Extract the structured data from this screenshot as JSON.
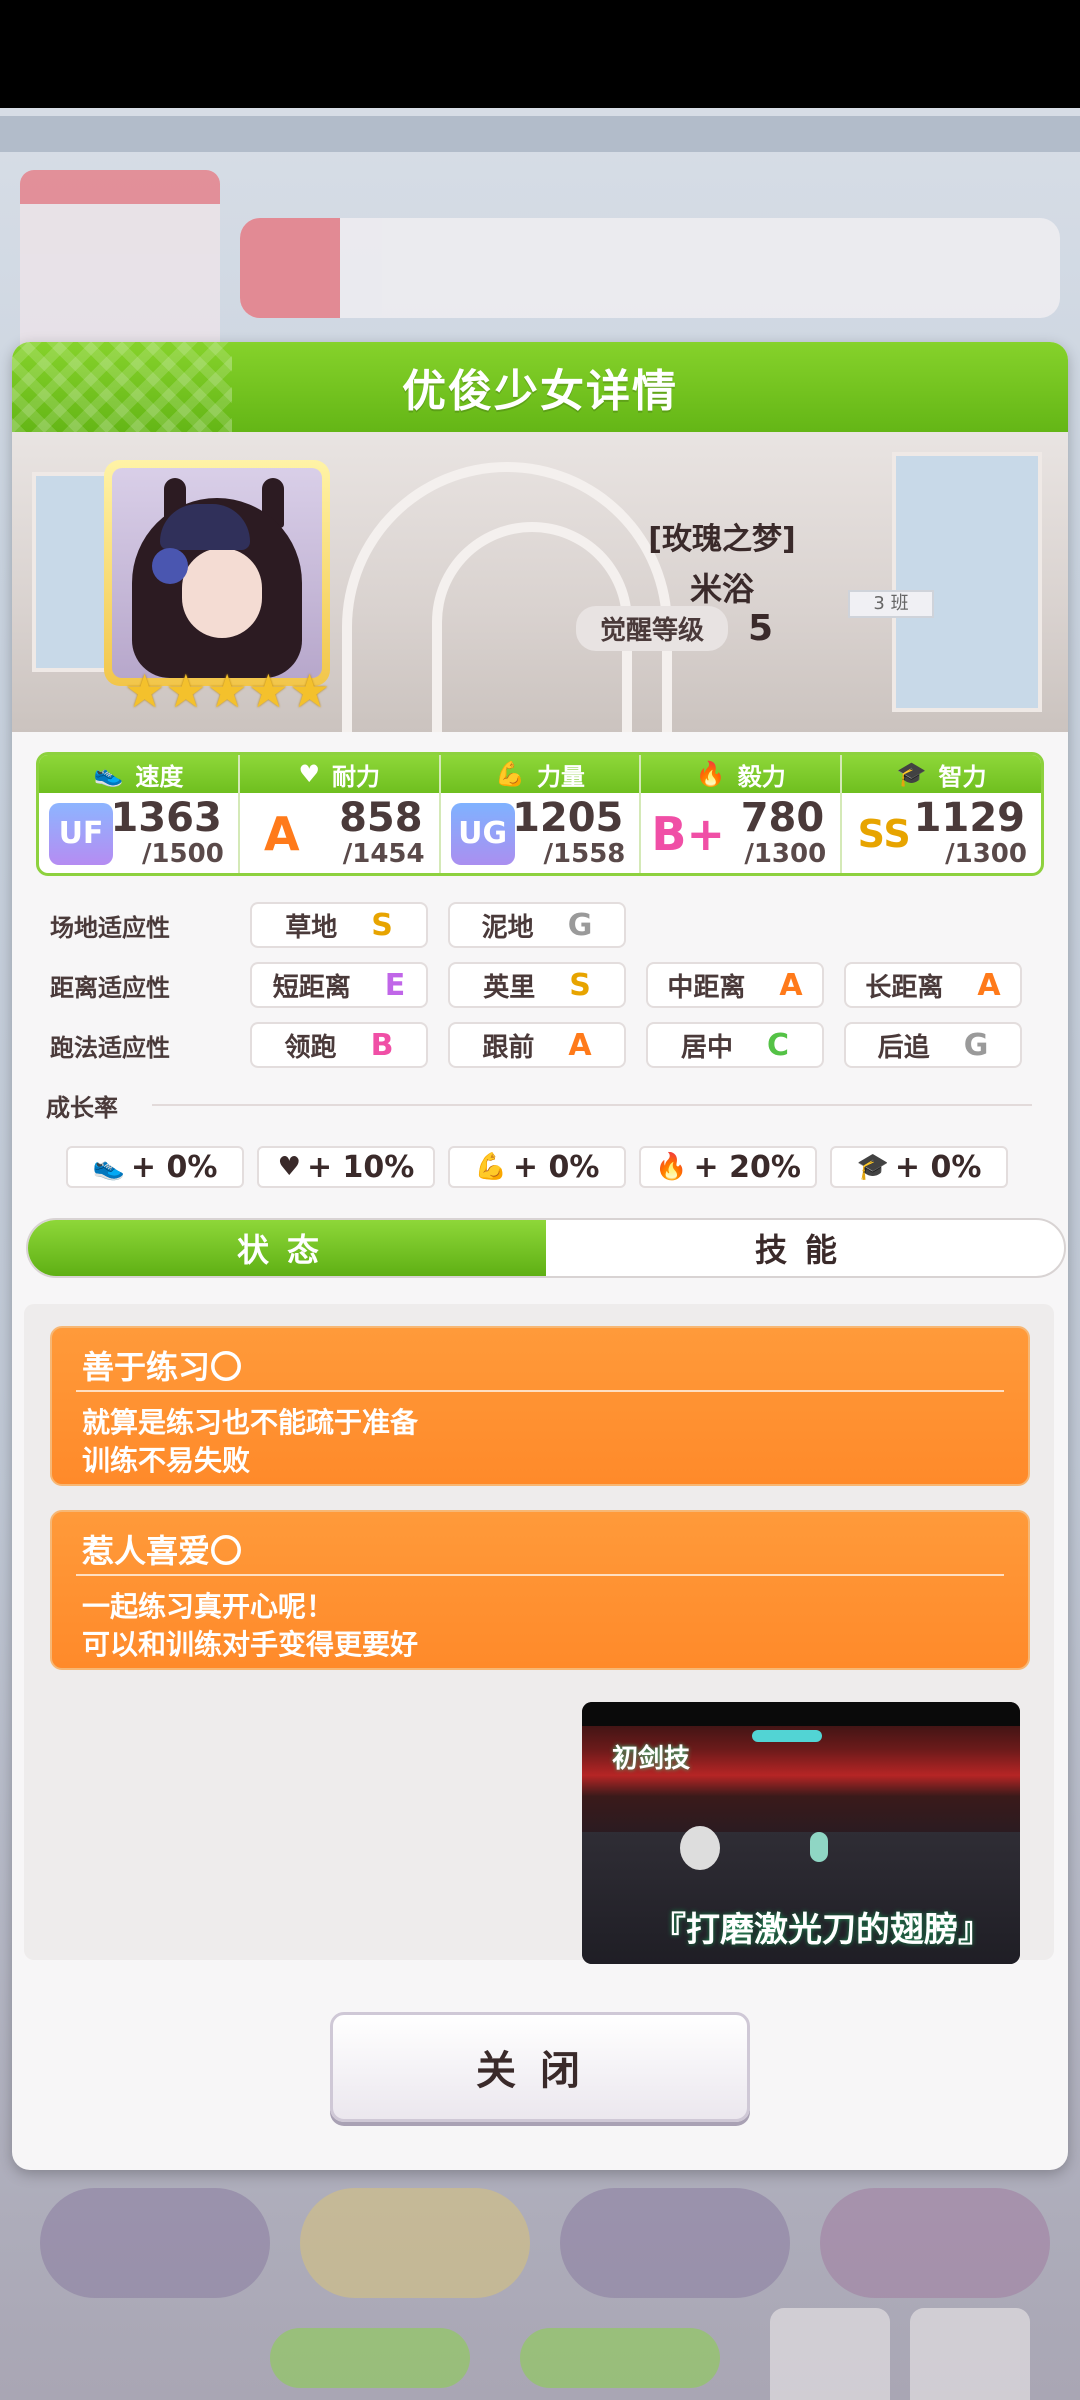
{
  "modal": {
    "title": "优俊少女详情",
    "epithet": "[玫瑰之梦]",
    "name": "米浴",
    "awaken_label": "觉醒等级",
    "awaken_level": "5",
    "class_tag": "3 班",
    "star_count": 5,
    "stars": [
      "★",
      "★",
      "★",
      "★",
      "★"
    ]
  },
  "stats": [
    {
      "label": "速度",
      "icon": "shoe-icon",
      "icon_glyph": "👟",
      "rank": "UF",
      "value": "1363",
      "max": "/1500"
    },
    {
      "label": "耐力",
      "icon": "heart-icon",
      "icon_glyph": "♥",
      "rank": "A",
      "value": "858",
      "max": "/1454"
    },
    {
      "label": "力量",
      "icon": "muscle-icon",
      "icon_glyph": "💪",
      "rank": "UG",
      "value": "1205",
      "max": "/1558"
    },
    {
      "label": "毅力",
      "icon": "flame-icon",
      "icon_glyph": "🔥",
      "rank": "B+",
      "value": "780",
      "max": "/1300"
    },
    {
      "label": "智力",
      "icon": "graduation-cap-icon",
      "icon_glyph": "🎓",
      "rank": "SS",
      "value": "1129",
      "max": "/1300"
    }
  ],
  "aptitude": {
    "track": {
      "label": "场地适应性",
      "items": [
        {
          "name": "草地",
          "grade": "S"
        },
        {
          "name": "泥地",
          "grade": "G"
        }
      ]
    },
    "distance": {
      "label": "距离适应性",
      "items": [
        {
          "name": "短距离",
          "grade": "E"
        },
        {
          "name": "英里",
          "grade": "S"
        },
        {
          "name": "中距离",
          "grade": "A"
        },
        {
          "name": "长距离",
          "grade": "A"
        }
      ]
    },
    "style": {
      "label": "跑法适应性",
      "items": [
        {
          "name": "领跑",
          "grade": "B"
        },
        {
          "name": "跟前",
          "grade": "A"
        },
        {
          "name": "居中",
          "grade": "C"
        },
        {
          "name": "后追",
          "grade": "G"
        }
      ]
    }
  },
  "growth": {
    "label": "成长率",
    "items": [
      {
        "icon": "shoe-icon",
        "glyph": "👟",
        "value": "+ 0%"
      },
      {
        "icon": "heart-icon",
        "glyph": "♥",
        "value": "+ 10%"
      },
      {
        "icon": "muscle-icon",
        "glyph": "💪",
        "value": "+ 0%"
      },
      {
        "icon": "flame-icon",
        "glyph": "🔥",
        "value": "+ 20%"
      },
      {
        "icon": "graduation-cap-icon",
        "glyph": "🎓",
        "value": "+ 0%"
      }
    ]
  },
  "tabs": [
    {
      "label": "状态",
      "active": true
    },
    {
      "label": "技能",
      "active": false
    }
  ],
  "skills": [
    {
      "name": "善于练习〇",
      "desc1": "就算是练习也不能疏于准备",
      "desc2": "训练不易失败"
    },
    {
      "name": "惹人喜爱〇",
      "desc1": "一起练习真开心呢！",
      "desc2": "可以和训练对手变得更要好"
    }
  ],
  "video": {
    "top_text": "初剑技",
    "caption": "『打磨激光刀的翅膀』"
  },
  "close_label": "关闭",
  "colors": {
    "header_green": "#6fbf1f",
    "skill_orange": "#ff8a2a",
    "rank_a": "#ff7a1a"
  }
}
